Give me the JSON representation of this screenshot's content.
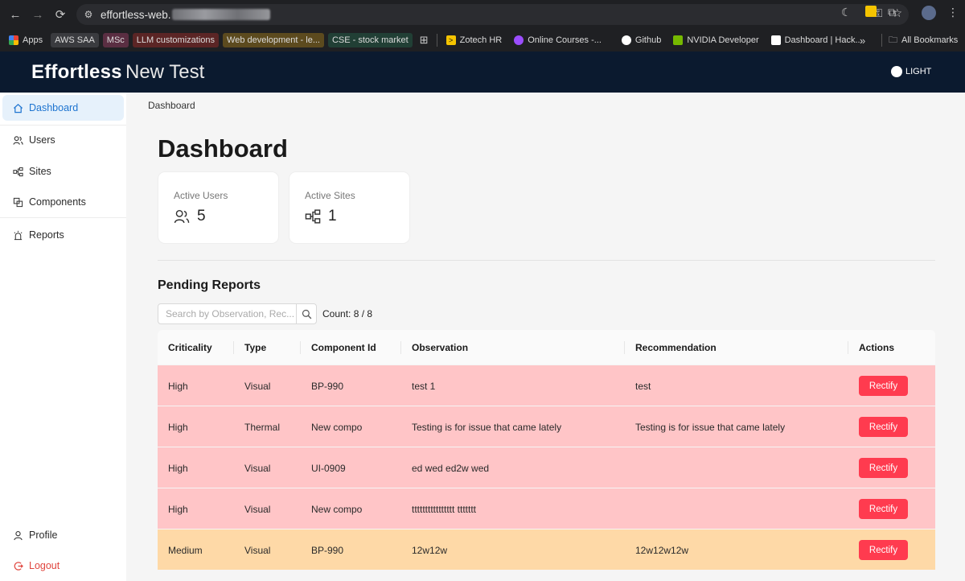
{
  "browser": {
    "url_prefix": "effortless-web.",
    "bookmarks": [
      {
        "label": "Apps",
        "bg": "transparent",
        "icon_color": "#ff9800"
      },
      {
        "label": "AWS SAA",
        "bg": "#3a3b3f",
        "icon_color": ""
      },
      {
        "label": "MSc",
        "bg": "#5a2e42",
        "icon_color": ""
      },
      {
        "label": "LLM customizations",
        "bg": "#5b2525",
        "icon_color": ""
      },
      {
        "label": "Web development - le...",
        "bg": "#5c4a1e",
        "icon_color": ""
      },
      {
        "label": "CSE - stock market",
        "bg": "#213f35",
        "icon_color": ""
      },
      {
        "label": "Zotech HR",
        "bg": "transparent",
        "icon_color": "#f5c400"
      },
      {
        "label": "Online Courses -...",
        "bg": "transparent",
        "icon_color": "#9b4dff"
      },
      {
        "label": "Github",
        "bg": "transparent",
        "icon_color": "#ffffff"
      },
      {
        "label": "NVIDIA Developer",
        "bg": "transparent",
        "icon_color": "#76b900"
      },
      {
        "label": "Dashboard | Hack...",
        "bg": "transparent",
        "icon_color": "#ffffff"
      }
    ],
    "all_bookmarks": "All Bookmarks",
    "overflow": "»"
  },
  "header": {
    "brand": "Effortless",
    "subtitle": "New Test",
    "theme_label": "LIGHT"
  },
  "sidebar": {
    "items": [
      {
        "label": "Dashboard",
        "icon": "home-icon"
      },
      {
        "label": "Users",
        "icon": "users-icon"
      },
      {
        "label": "Sites",
        "icon": "sites-icon"
      },
      {
        "label": "Components",
        "icon": "components-icon"
      },
      {
        "label": "Reports",
        "icon": "alarm-icon"
      }
    ],
    "profile": "Profile",
    "logout": "Logout"
  },
  "main": {
    "breadcrumb": "Dashboard",
    "title": "Dashboard",
    "stats": [
      {
        "label": "Active Users",
        "value": "5",
        "icon": "users-icon"
      },
      {
        "label": "Active Sites",
        "value": "1",
        "icon": "sites-icon"
      }
    ],
    "pending_title": "Pending Reports",
    "search_placeholder": "Search by Observation, Rec...",
    "count": "Count: 8 / 8",
    "columns": [
      "Criticality",
      "Type",
      "Component Id",
      "Observation",
      "Recommendation",
      "Actions"
    ],
    "rows": [
      {
        "criticality": "High",
        "type": "Visual",
        "component": "BP-990",
        "observation": "test 1",
        "recommendation": "test",
        "action": "Rectify"
      },
      {
        "criticality": "High",
        "type": "Thermal",
        "component": "New compo",
        "observation": "Testing is for issue that came lately",
        "recommendation": "Testing is for issue that came lately",
        "action": "Rectify"
      },
      {
        "criticality": "High",
        "type": "Visual",
        "component": "UI-0909",
        "observation": "ed wed ed2w wed",
        "recommendation": "",
        "action": "Rectify"
      },
      {
        "criticality": "High",
        "type": "Visual",
        "component": "New compo",
        "observation": "tttttttttttttttt ttttttt",
        "recommendation": "",
        "action": "Rectify"
      },
      {
        "criticality": "Medium",
        "type": "Visual",
        "component": "BP-990",
        "observation": "12w12w",
        "recommendation": "12w12w12w",
        "action": "Rectify"
      }
    ]
  },
  "colors": {
    "header_bg": "#0b1a2f",
    "high_row": "#ffc5c7",
    "medium_row": "#fed9a7",
    "rectify": "#ff3b4f",
    "active_nav": "#1d74d0"
  }
}
